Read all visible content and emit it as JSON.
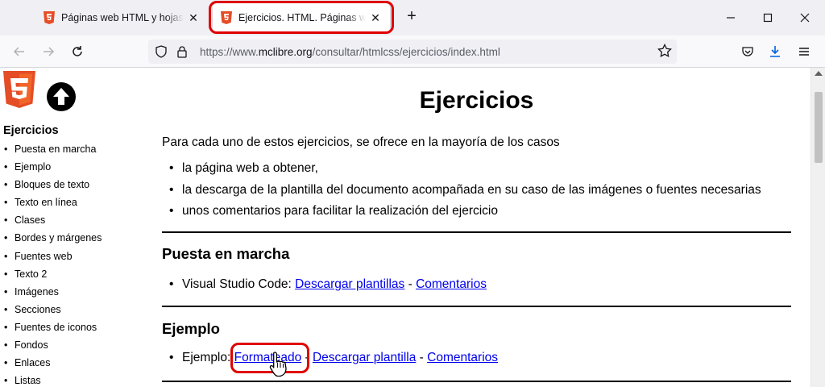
{
  "browser": {
    "tabs": [
      {
        "title": "Páginas web HTML y hojas de estilo CSS",
        "active": false
      },
      {
        "title": "Ejercicios. HTML. Páginas web HTML",
        "active": true
      }
    ],
    "close_glyph": "✕",
    "new_tab_glyph": "+",
    "url_prefix": "https://www.",
    "url_domain": "mclibre.org",
    "url_path": "/consultar/htmlcss/ejercicios/index.html",
    "highlight_color": "#e00000"
  },
  "sidebar": {
    "heading": "Ejercicios",
    "items": [
      "Puesta en marcha",
      "Ejemplo",
      "Bloques de texto",
      "Texto en línea",
      "Clases",
      "Bordes y márgenes",
      "Fuentes web",
      "Texto 2",
      "Imágenes",
      "Secciones",
      "Fuentes de iconos",
      "Fondos",
      "Enlaces",
      "Listas"
    ]
  },
  "main": {
    "title": "Ejercicios",
    "intro": "Para cada uno de estos ejercicios, se ofrece en la mayoría de los casos",
    "bullets": [
      "la página web a obtener,",
      "la descarga de la plantilla del documento acompañada en su caso de las imágenes o fuentes necesarias",
      "unos comentarios para facilitar la realización del ejercicio"
    ],
    "sections": [
      {
        "heading": "Puesta en marcha",
        "item_label": "Visual Studio Code: ",
        "link1": "Descargar plantillas",
        "sep1": " - ",
        "link2": "Comentarios"
      },
      {
        "heading": "Ejemplo",
        "item_label": "Ejemplo: ",
        "link1": "Formateado",
        "sep1": " - ",
        "link2": "Descargar plantilla",
        "sep2": " - ",
        "link3": "Comentarios"
      }
    ]
  }
}
